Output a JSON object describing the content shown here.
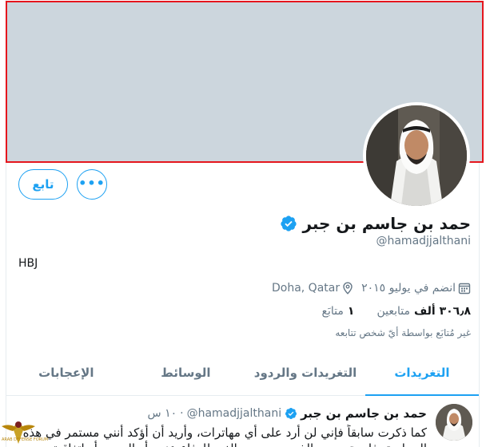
{
  "profile": {
    "display_name": "حمد بن جاسم بن جبر",
    "handle": "@hamadjjalthani",
    "bio": "HBJ",
    "location": "Doha, Qatar",
    "joined": "انضم في يوليو ٢٠١٥",
    "following_count": "١",
    "following_label": "متابَع",
    "followers_count": "٣٠٦٫٨ ألف",
    "followers_label": "متابعين",
    "followed_by_note": "غير مُتابَع بواسطة أيّ شخص تتابعه",
    "verified": true
  },
  "actions": {
    "follow_label": "تابع",
    "more_label": "•••"
  },
  "tabs": [
    {
      "label": "التغريدات",
      "active": true
    },
    {
      "label": "التغريدات والردود",
      "active": false
    },
    {
      "label": "الوسائط",
      "active": false
    },
    {
      "label": "الإعجابات",
      "active": false
    }
  ],
  "tweet": {
    "name": "حمد بن جاسم بن جبر",
    "handle": "@hamadjjalthani",
    "separator": "·",
    "time": "١٠ س",
    "text": "كما ذكرت سابقاً فإني لن أرد على أي مهاترات، وأريد أن أؤكد أنني مستمر في هذه السياسة. فليستمر من الذين يحرضون الغير للدفاع عنهم أو الهجوم أو اتفاقية"
  },
  "watermark": {
    "text": "ARAB DEFENSE FORUM"
  },
  "colors": {
    "accent": "#1da1f2",
    "banner": "#ccd6dd",
    "highlight_border": "#e5161d"
  }
}
